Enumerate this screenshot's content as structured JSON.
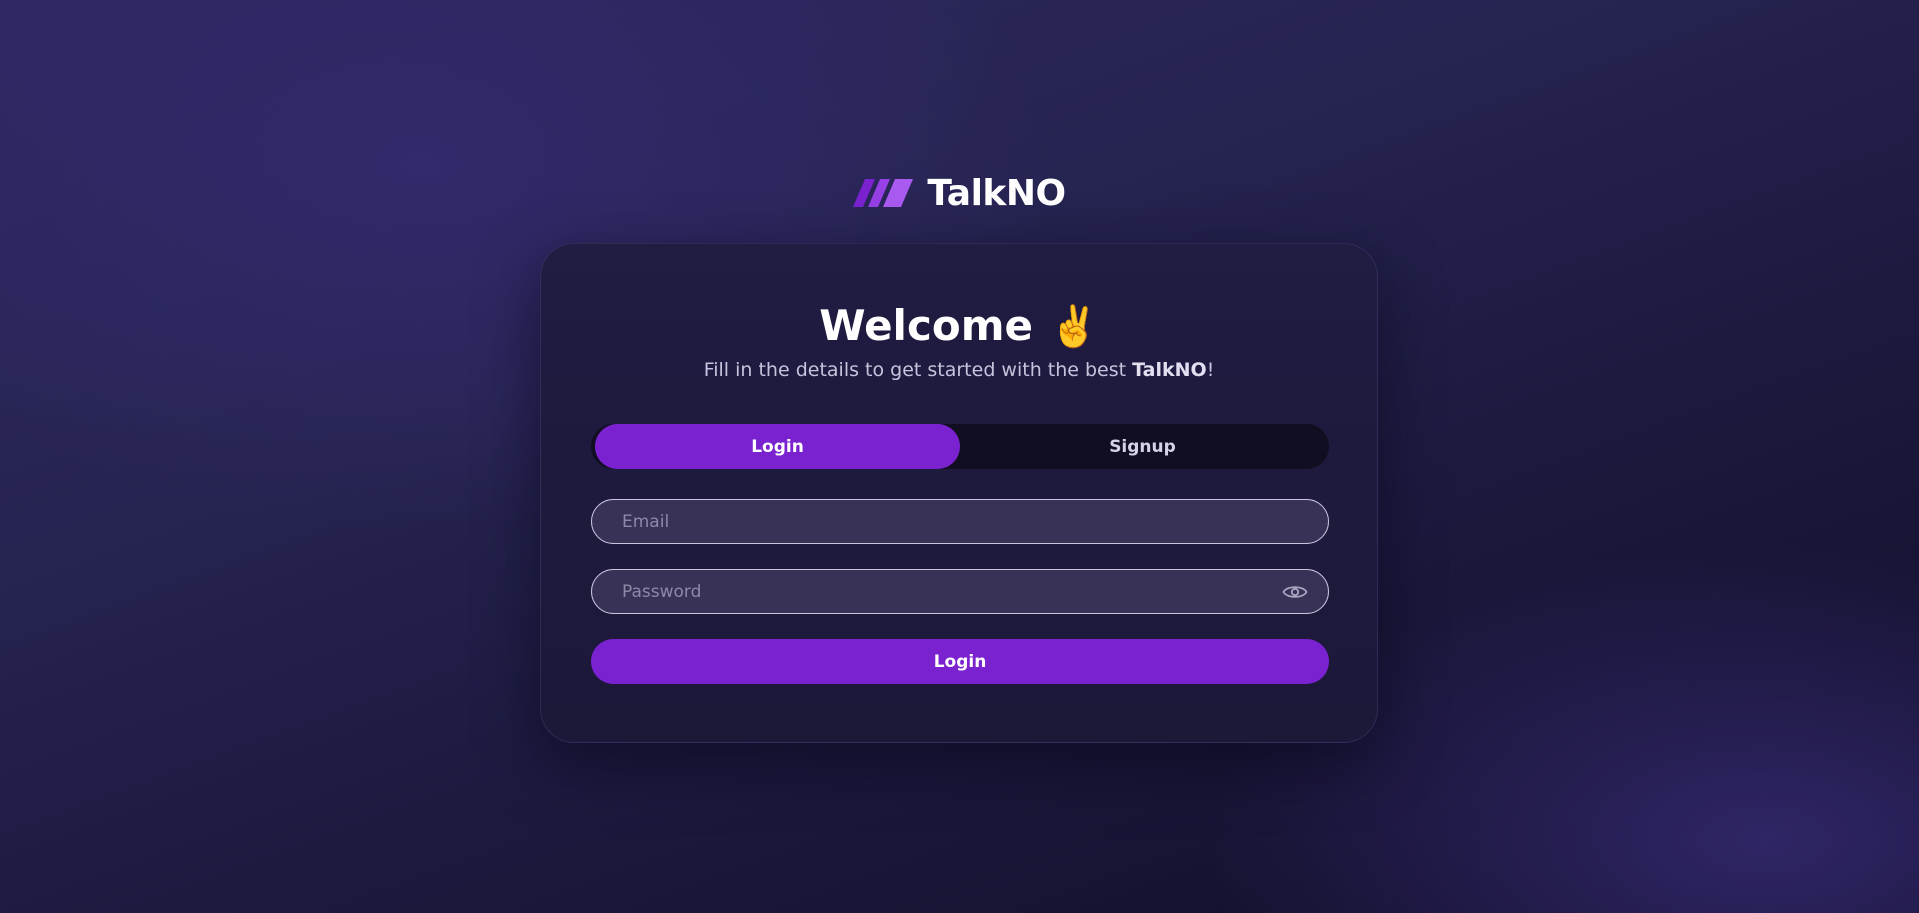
{
  "brand": {
    "name": "TalkNO",
    "logo_icon": "slashes-logo-icon"
  },
  "card": {
    "title": "Welcome",
    "title_emoji": "✌️",
    "subtitle_prefix": "Fill in the details to get started with the best ",
    "subtitle_brand": "TalkNO",
    "subtitle_suffix": "!"
  },
  "tabs": [
    {
      "label": "Login",
      "active": true
    },
    {
      "label": "Signup",
      "active": false
    }
  ],
  "form": {
    "email": {
      "value": "",
      "placeholder": "Email"
    },
    "password": {
      "value": "",
      "placeholder": "Password",
      "toggle_icon": "eye-icon"
    },
    "submit_label": "Login"
  },
  "colors": {
    "accent": "#7b22d0",
    "logo_stripe_dark": "#7b22d0",
    "logo_stripe_light": "#a95af0",
    "card_background": "#1e1a3f",
    "field_background": "#373256"
  }
}
